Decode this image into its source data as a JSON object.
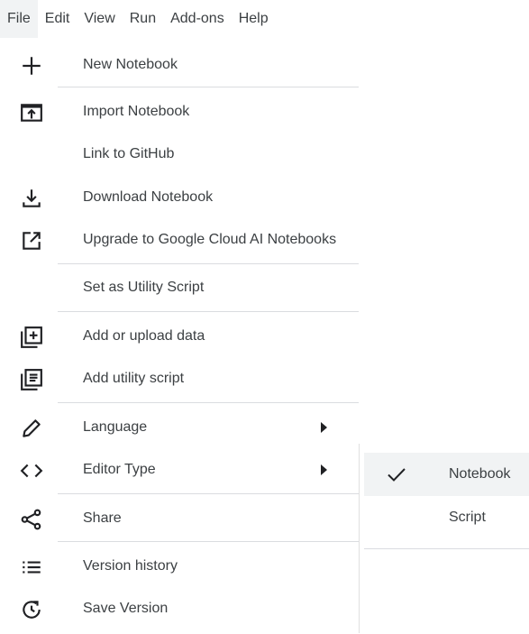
{
  "menubar": {
    "items": [
      "File",
      "Edit",
      "View",
      "Run",
      "Add-ons",
      "Help"
    ]
  },
  "file_menu": {
    "items": [
      {
        "label": "New Notebook",
        "icon": "plus-icon"
      },
      {
        "label": "Import Notebook",
        "icon": "import-icon"
      },
      {
        "label": "Link to GitHub",
        "icon": ""
      },
      {
        "label": "Download Notebook",
        "icon": "download-icon"
      },
      {
        "label": "Upgrade to Google Cloud AI Notebooks",
        "icon": "open-external-icon"
      },
      {
        "label": "Set as Utility Script",
        "icon": ""
      },
      {
        "label": "Add or upload data",
        "icon": "add-data-icon"
      },
      {
        "label": "Add utility script",
        "icon": "utility-script-icon"
      },
      {
        "label": "Language",
        "icon": "pencil-icon",
        "has_submenu": true
      },
      {
        "label": "Editor Type",
        "icon": "code-icon",
        "has_submenu": true
      },
      {
        "label": "Share",
        "icon": "share-icon"
      },
      {
        "label": "Version history",
        "icon": "list-icon"
      },
      {
        "label": "Save Version",
        "icon": "save-version-icon"
      }
    ]
  },
  "editor_type_submenu": {
    "items": [
      {
        "label": "Notebook",
        "selected": true,
        "icon": "check-icon"
      },
      {
        "label": "Script",
        "selected": false
      }
    ]
  }
}
